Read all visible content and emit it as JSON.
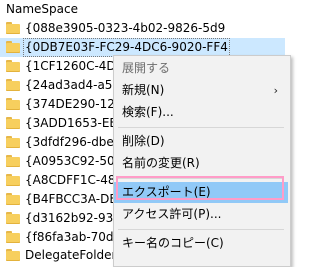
{
  "tree": {
    "header": "NameSpace",
    "rows": [
      {
        "label": "{088e3905-0323-4b02-9826-5d9"
      },
      {
        "label": "{0DB7E03F-FC29-4DC6-9020-FF4"
      },
      {
        "label": "{1CF1260C-4DD0-"
      },
      {
        "label": "{24ad3ad4-a569-4"
      },
      {
        "label": "{374DE290-123F-4"
      },
      {
        "label": "{3ADD1653-EB32-"
      },
      {
        "label": "{3dfdf296-dbec-4"
      },
      {
        "label": "{A0953C92-50DC-"
      },
      {
        "label": "{A8CDFF1C-4878-"
      },
      {
        "label": "{B4FBCC3A-DB2"
      },
      {
        "label": "{d3162b92-9365-"
      },
      {
        "label": "{f86fa3ab-70d2-4"
      },
      {
        "label": "DelegateFolders"
      }
    ]
  },
  "context_menu": {
    "expand": "展開する",
    "new": "新規(N)",
    "find": "検索(F)...",
    "delete": "削除(D)",
    "rename": "名前の変更(R)",
    "export": "エクスポート(E)",
    "permissions": "アクセス許可(P)...",
    "copy_key_name": "キー名のコピー(C)",
    "submenu_arrow": "›"
  },
  "colors": {
    "selection": "#cce8ff",
    "menu_highlight": "#91c9f7",
    "callout": "#ff9cc8",
    "folder": "#f7cf5e"
  },
  "icons": {
    "folder": "folder-icon",
    "submenu": "chevron-right-icon"
  }
}
